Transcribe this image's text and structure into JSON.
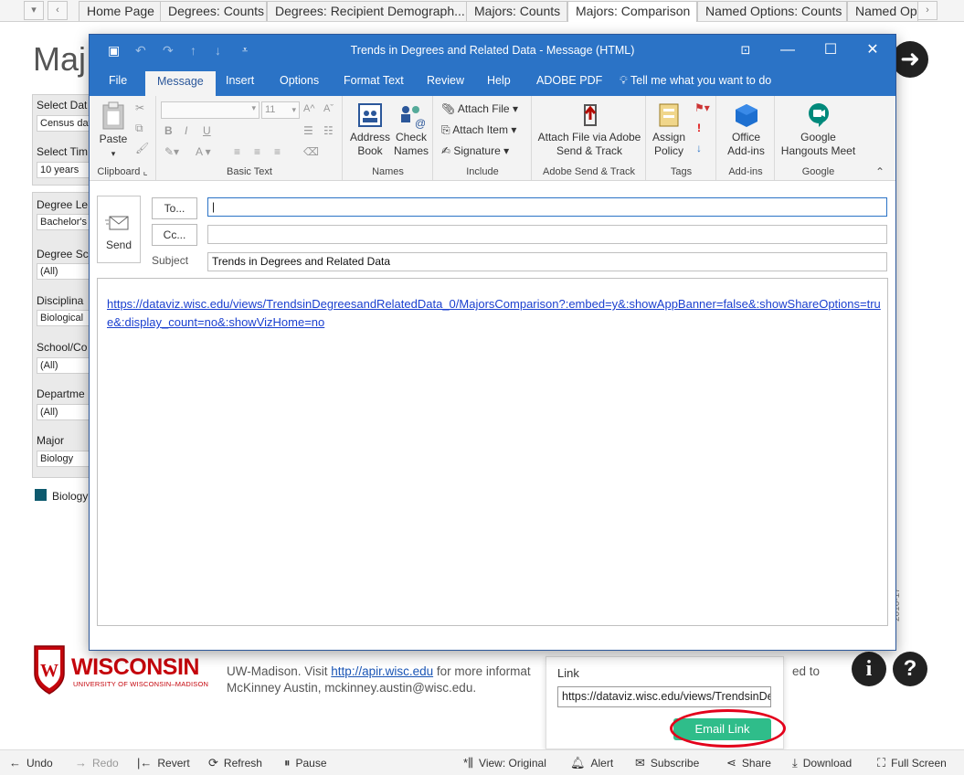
{
  "tableau": {
    "tabs": [
      "Home Page",
      "Degrees: Counts",
      "Degrees: Recipient Demograph...",
      "Majors: Counts",
      "Majors: Comparison",
      "Named Options: Counts",
      "Named Op"
    ],
    "active_tab": "Majors: Comparison",
    "page_title_fragment": "Maj",
    "filters": [
      {
        "label": "Select Dat",
        "value": "Census dat"
      },
      {
        "label": "Select Tim",
        "value": "10 years"
      },
      {
        "label": "Degree Le",
        "value": "Bachelor's"
      },
      {
        "label": "Degree Sc",
        "value": "(All)"
      },
      {
        "label": "Disciplina",
        "value": "Biological"
      },
      {
        "label": "School/Co",
        "value": "(All)"
      },
      {
        "label": "Departme",
        "value": "(All)"
      },
      {
        "label": "Major",
        "value": "Biology"
      }
    ],
    "legend_item": "Biology",
    "side_label": "2016-17",
    "footer": {
      "logo_word": "WISCONSIN",
      "logo_sub": "UNIVERSITY OF WISCONSIN–MADISON",
      "line1_prefix": "UW-Madison. Visit ",
      "line1_link": "http://apir.wisc.edu",
      "line1_suffix": " for more informat",
      "line1_right": "ed to",
      "line2": "McKinney Austin, mckinney.austin@wisc.edu."
    },
    "share": {
      "label": "Link",
      "link_value": "https://dataviz.wisc.edu/views/TrendsinDegreesandRelatedData_0/MajorsComparison",
      "email_button": "Email Link"
    },
    "toolbar": [
      "Undo",
      "Redo",
      "Revert",
      "Refresh",
      "Pause",
      "View: Original",
      "Alert",
      "Subscribe",
      "Share",
      "Download",
      "Full Screen"
    ]
  },
  "outlook": {
    "title": "Trends in Degrees and Related Data  -  Message (HTML)",
    "menu_tabs": [
      "File",
      "Message",
      "Insert",
      "Options",
      "Format Text",
      "Review",
      "Help",
      "ADOBE PDF"
    ],
    "active_menu": "Message",
    "tell_me": "Tell me what you want to do",
    "ribbon": {
      "clipboard": {
        "paste": "Paste",
        "group": "Clipboard"
      },
      "basic_text": {
        "font_size": "11",
        "group": "Basic Text"
      },
      "names": {
        "address_book": "Address Book",
        "check_names": "Check Names",
        "group": "Names"
      },
      "include": {
        "attach_file": "Attach File",
        "attach_item": "Attach Item",
        "signature": "Signature",
        "group": "Include"
      },
      "adobe": {
        "button": "Attach File via Adobe Send & Track",
        "group": "Adobe Send & Track"
      },
      "tags": {
        "assign_policy": "Assign Policy",
        "group": "Tags"
      },
      "addins": {
        "office_addins": "Office Add-ins",
        "group": "Add-ins"
      },
      "google": {
        "hangouts": "Google Hangouts Meet",
        "group": "Google"
      }
    },
    "send_label": "Send",
    "to_label": "To...",
    "cc_label": "Cc...",
    "subject_label": "Subject",
    "subject_value": "Trends in Degrees and Related Data",
    "to_value": "",
    "cc_value": "",
    "body_link": "https://dataviz.wisc.edu/views/TrendsinDegreesandRelatedData_0/MajorsComparison?:embed=y&:showAppBanner=false&:showShareOptions=true&:display_count=no&:showVizHome=no"
  },
  "colors": {
    "outlook_blue": "#2b73c6",
    "email_button": "#2fbd8a",
    "highlight_oval": "#e3001b",
    "uw_red": "#c5050c"
  }
}
